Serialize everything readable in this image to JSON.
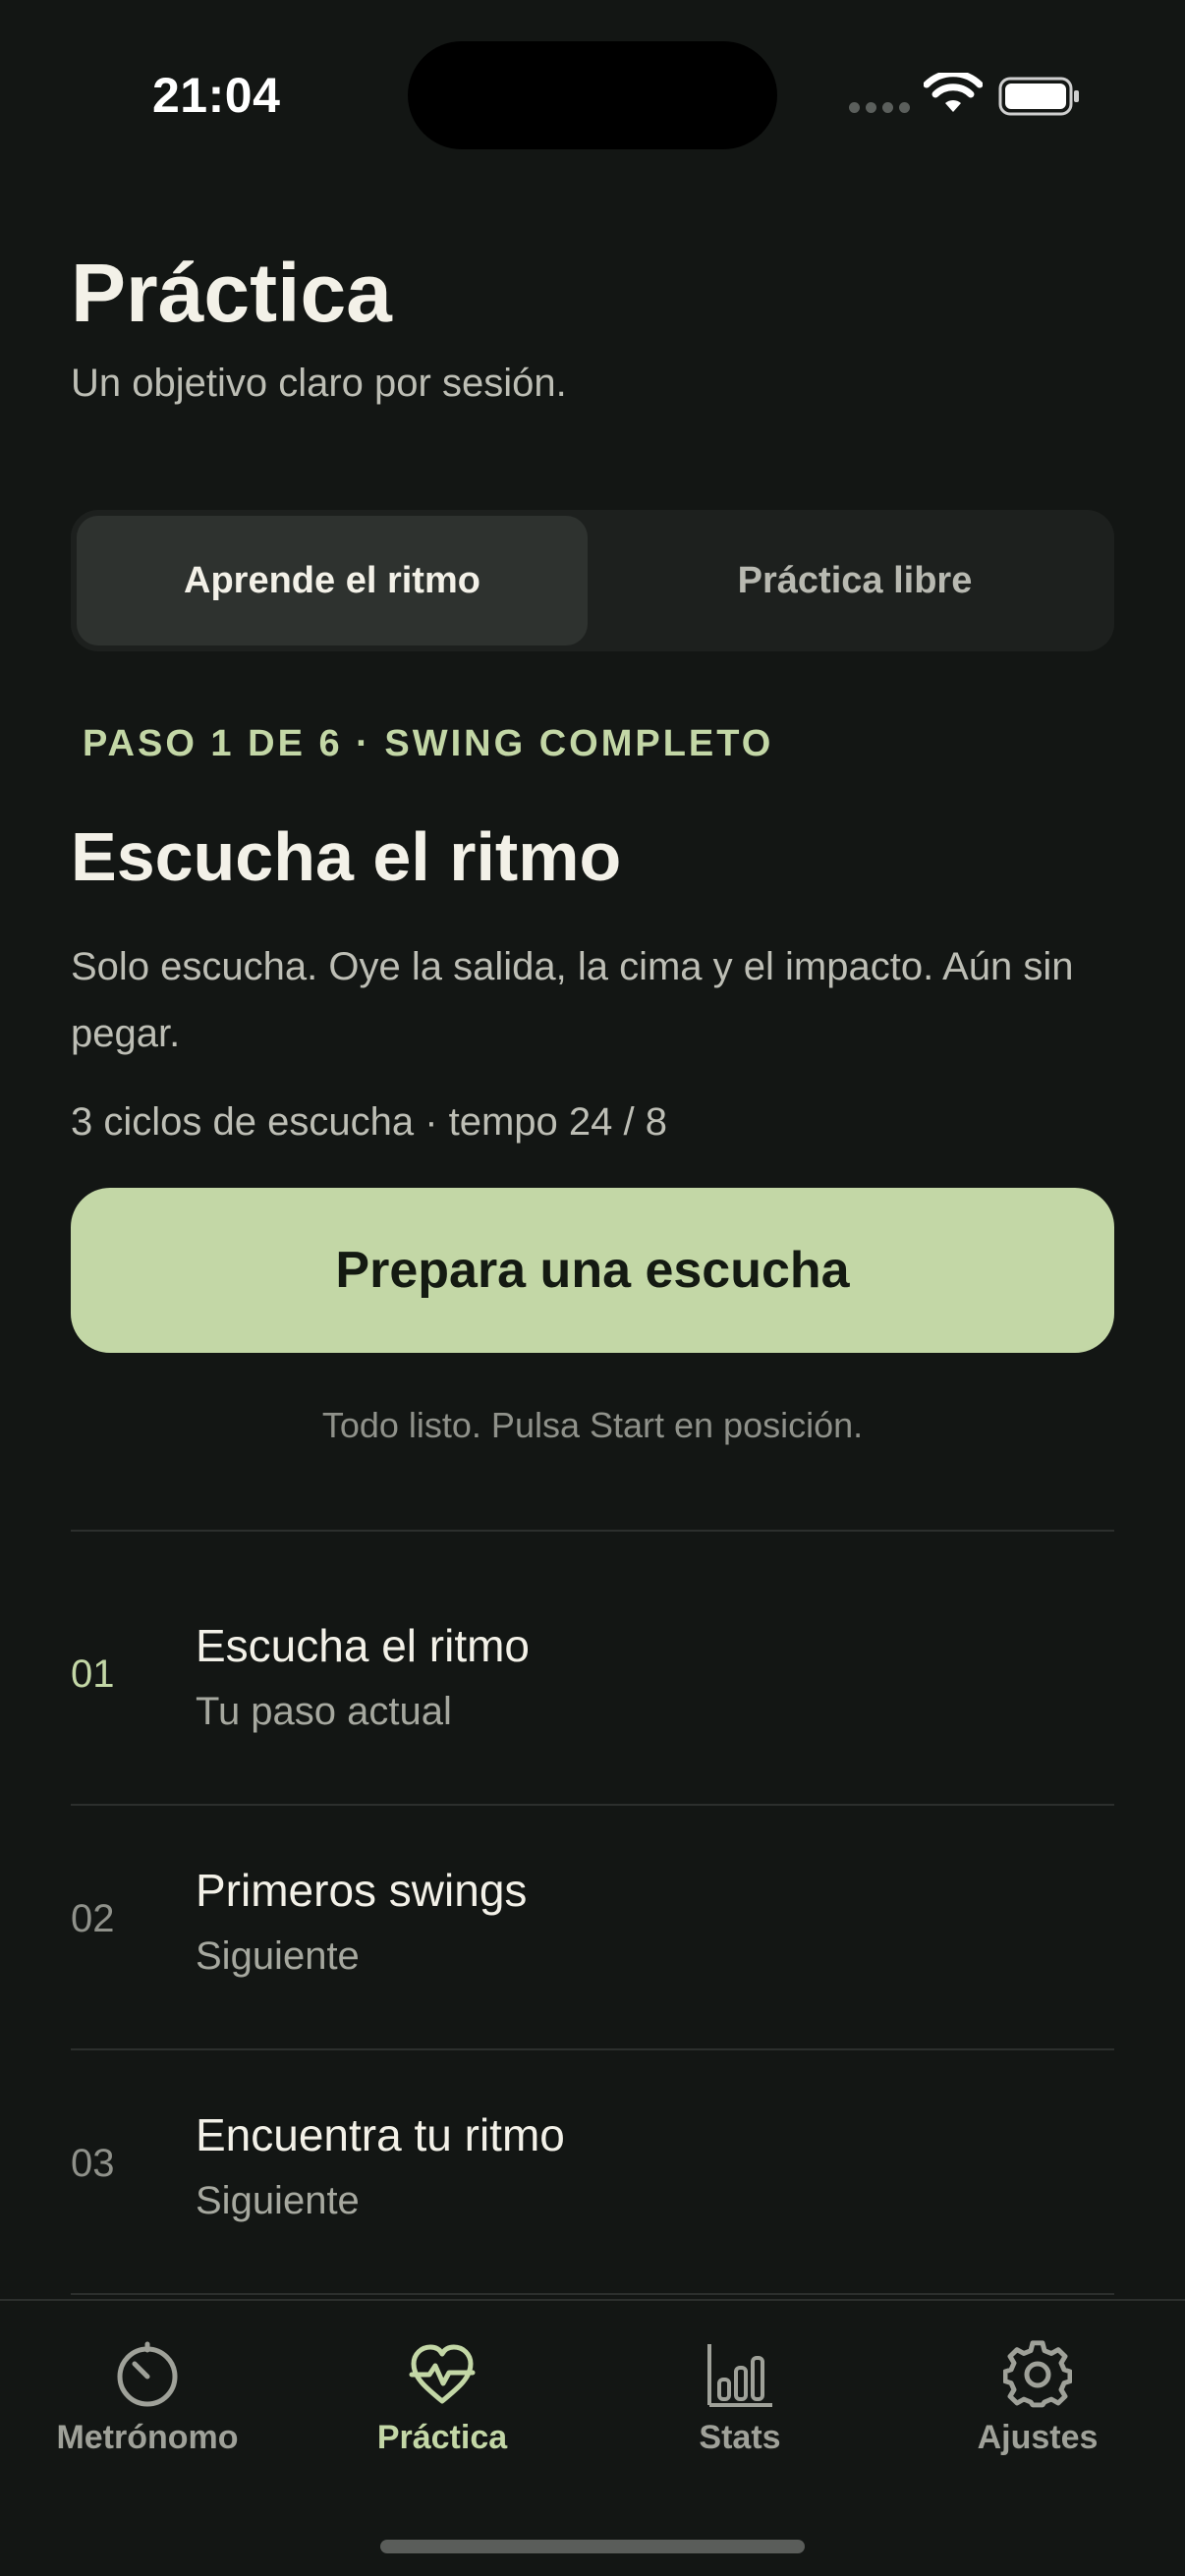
{
  "status_bar": {
    "time": "21:04"
  },
  "header": {
    "title": "Práctica",
    "subtitle": "Un objetivo claro por sesión."
  },
  "segmented": {
    "options": [
      "Aprende el ritmo",
      "Práctica libre"
    ],
    "selected": "Aprende el ritmo"
  },
  "step": {
    "kicker": "PASO 1 DE 6 · SWING COMPLETO",
    "title": "Escucha el ritmo",
    "description": "Solo escucha. Oye la salida, la cima y el impacto. Aún sin pegar.",
    "meta": "3 ciclos de escucha · tempo 24 / 8",
    "button_label": "Prepara una escucha",
    "hint": "Todo listo. Pulsa Start en posición."
  },
  "steps_list": [
    {
      "number": "01",
      "title": "Escucha el ritmo",
      "status": "Tu paso actual"
    },
    {
      "number": "02",
      "title": "Primeros swings",
      "status": "Siguiente"
    },
    {
      "number": "03",
      "title": "Encuentra tu ritmo",
      "status": "Siguiente"
    }
  ],
  "tabbar": {
    "items": [
      {
        "label": "Metrónomo",
        "icon": "metronome-gauge-icon"
      },
      {
        "label": "Práctica",
        "icon": "heart-pulse-icon"
      },
      {
        "label": "Stats",
        "icon": "bar-chart-icon"
      },
      {
        "label": "Ajustes",
        "icon": "gear-icon"
      }
    ],
    "active": "Práctica"
  },
  "colors": {
    "background": "#131614",
    "accent": "#c3d7a6",
    "text_primary": "#f3f1e8",
    "text_secondary": "#bdbeb5"
  }
}
